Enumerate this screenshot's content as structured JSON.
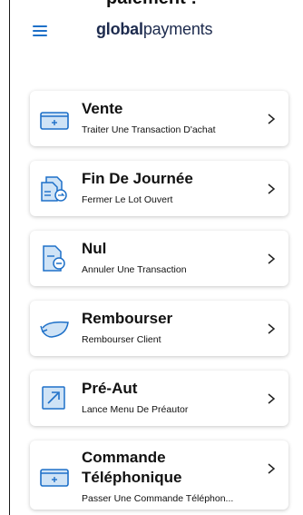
{
  "page": {
    "cutoff_heading": "paiement :"
  },
  "header": {
    "logo_bold": "global",
    "logo_light": "payments"
  },
  "colors": {
    "accent": "#1e70c8",
    "icon_fill": "#cfe3f6",
    "text": "#111111"
  },
  "menu": [
    {
      "title": "Vente",
      "subtitle": "Traiter Une Transaction D'achat",
      "icon": "card-icon"
    },
    {
      "title": "Fin De Journée",
      "subtitle": "Fermer Le Lot Ouvert",
      "icon": "batch-close-icon"
    },
    {
      "title": "Nul",
      "subtitle": "Annuler Une Transaction",
      "icon": "void-document-icon"
    },
    {
      "title": "Rembourser",
      "subtitle": "Rembourser Client",
      "icon": "refund-icon"
    },
    {
      "title": "Pré-Aut",
      "subtitle": "Lance Menu De Préautor",
      "icon": "pre-auth-icon"
    },
    {
      "title": "Commande Téléphonique",
      "subtitle": "Passer Une Commande Téléphon...",
      "icon": "card-icon"
    }
  ]
}
